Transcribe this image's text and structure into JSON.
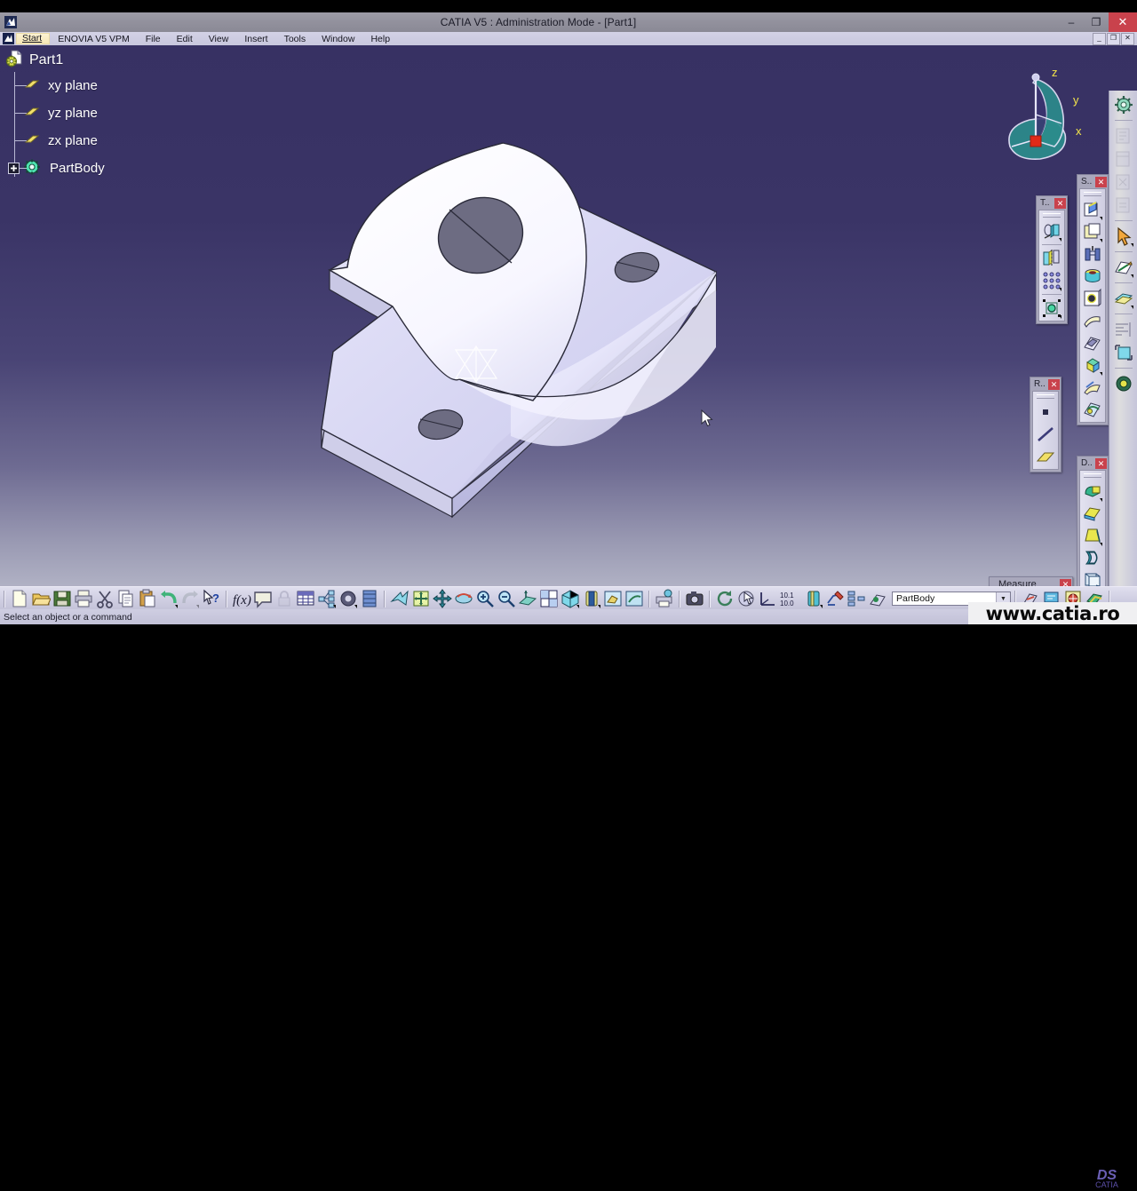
{
  "window": {
    "title": "CATIA V5 : Administration Mode - [Part1]",
    "app_icon": "catia-app-icon",
    "controls": {
      "minimize": "–",
      "restore": "❐",
      "close": "✕"
    }
  },
  "menubar": {
    "app_icon": "catia-document-icon",
    "start": "Start",
    "items": [
      "ENOVIA V5 VPM",
      "File",
      "Edit",
      "View",
      "Insert",
      "Tools",
      "Window",
      "Help"
    ],
    "mdi_controls": {
      "minimize": "_",
      "restore": "❐",
      "close": "✕"
    }
  },
  "tree": {
    "root": {
      "label": "Part1",
      "icon": "part-document-icon"
    },
    "nodes": [
      {
        "label": "xy plane",
        "icon": "plane-icon"
      },
      {
        "label": "yz plane",
        "icon": "plane-icon"
      },
      {
        "label": "zx plane",
        "icon": "plane-icon"
      },
      {
        "label": "PartBody",
        "icon": "partbody-icon",
        "expander": "plus-expander-icon"
      }
    ]
  },
  "compass": {
    "x": "x",
    "y": "y",
    "z": "z"
  },
  "viewport": {
    "model_name": "bearing-block-3d-model",
    "axis_system_symbol": "axis-system-triad",
    "bg_top": "#373163",
    "bg_bottom": "#b0b1c4"
  },
  "floating_toolbars": [
    {
      "name": "transformations-toolbar",
      "title": "T..",
      "close": "✕",
      "icons": [
        "translate-icon",
        "mirror-icon",
        "rectangular-pattern-icon",
        "scaling-icon"
      ]
    },
    {
      "name": "sketch-based-features-toolbar",
      "title": "S..",
      "close": "✕",
      "icons": [
        "pad-icon",
        "pocket-icon",
        "shaft-icon",
        "groove-icon",
        "hole-icon",
        "rib-icon",
        "slot-icon",
        "multi-sections-solid-icon",
        "stiffener-icon",
        "solid-combine-icon"
      ]
    },
    {
      "name": "reference-elements-toolbar",
      "title": "R..",
      "close": "✕",
      "icons": [
        "point-icon",
        "line-icon",
        "plane-icon"
      ]
    },
    {
      "name": "dress-up-features-toolbar",
      "title": "D..",
      "close": "✕",
      "icons": [
        "fillet-icon",
        "chamfer-icon",
        "draft-icon",
        "shell-icon",
        "thickness-icon",
        "thread-tap-icon",
        "remove-face-icon"
      ]
    },
    {
      "name": "measure-toolbar",
      "title": "Measure",
      "close": "✕",
      "icons": [
        "measure-between-icon",
        "measure-item-icon",
        "measure-inertia-icon"
      ]
    }
  ],
  "right_dock": {
    "name": "view-and-select-toolbar",
    "icons": [
      "gear-icon",
      "apply-material-icon",
      "catalog-icon",
      "power-copy-icon",
      "publication-icon",
      "select-arrow-icon",
      "sketcher-icon",
      "apply-material-stack-icon",
      "analysis-icon",
      "workbench-icon",
      "knowledge-icon"
    ]
  },
  "bottom_toolbar": {
    "standard": [
      "new-icon",
      "open-icon",
      "save-icon",
      "print-icon",
      "cut-icon",
      "copy-icon",
      "paste-icon",
      "undo-icon",
      "redo-icon",
      "whats-this-icon"
    ],
    "knowledge": [
      "formula-icon",
      "comment-icon",
      "lock-icon",
      "design-table-icon",
      "knowledge-inspector-icon",
      "power-copy-icon",
      "catalog-icon"
    ],
    "view": [
      "fly-mode-icon",
      "fit-all-in-icon",
      "pan-icon",
      "rotate-icon",
      "zoom-in-icon",
      "zoom-out-icon",
      "normal-view-icon",
      "multi-view-icon",
      "isometric-view-icon",
      "render-style-icon",
      "hide-show-icon",
      "swap-visible-space-icon"
    ],
    "tools": [
      "quick-print-icon",
      "capture-icon"
    ],
    "analysis": [
      "update-icon",
      "touch-icon",
      "axis-icon"
    ],
    "measure_values": "10.1 / 10.0",
    "extra": [
      "sketch-analysis-icon",
      "apply-material-icon",
      "catalog-browser-icon",
      "paint-icon"
    ],
    "combo": {
      "value": "PartBody",
      "arrow": "▼"
    }
  },
  "status": {
    "text": "Select an object or a command"
  },
  "watermark": {
    "text": "www.catia.ro",
    "logo_ds": "DS",
    "logo_sub": "CATIA"
  }
}
